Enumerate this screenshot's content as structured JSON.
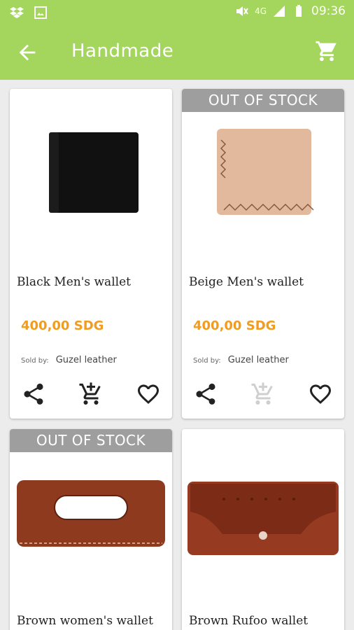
{
  "status": {
    "network": "4G",
    "time": "09:36"
  },
  "appbar": {
    "title": "Handmade"
  },
  "colors": {
    "accent": "#a4d65e",
    "price": "#f29b1d",
    "ribbon": "#9e9e9e"
  },
  "products": [
    {
      "name": "Black Men's wallet",
      "price": "400,00 SDG",
      "sold_by_label": "Sold by:",
      "seller": "Guzel leather",
      "badge": ""
    },
    {
      "name": "Beige Men's wallet",
      "price": "400,00 SDG",
      "sold_by_label": "Sold by:",
      "seller": "Guzel leather",
      "badge": "OUT OF STOCK"
    },
    {
      "name": "Brown women's wallet",
      "badge": "OUT OF STOCK"
    },
    {
      "name": "Brown Rufoo wallet",
      "badge": ""
    }
  ]
}
